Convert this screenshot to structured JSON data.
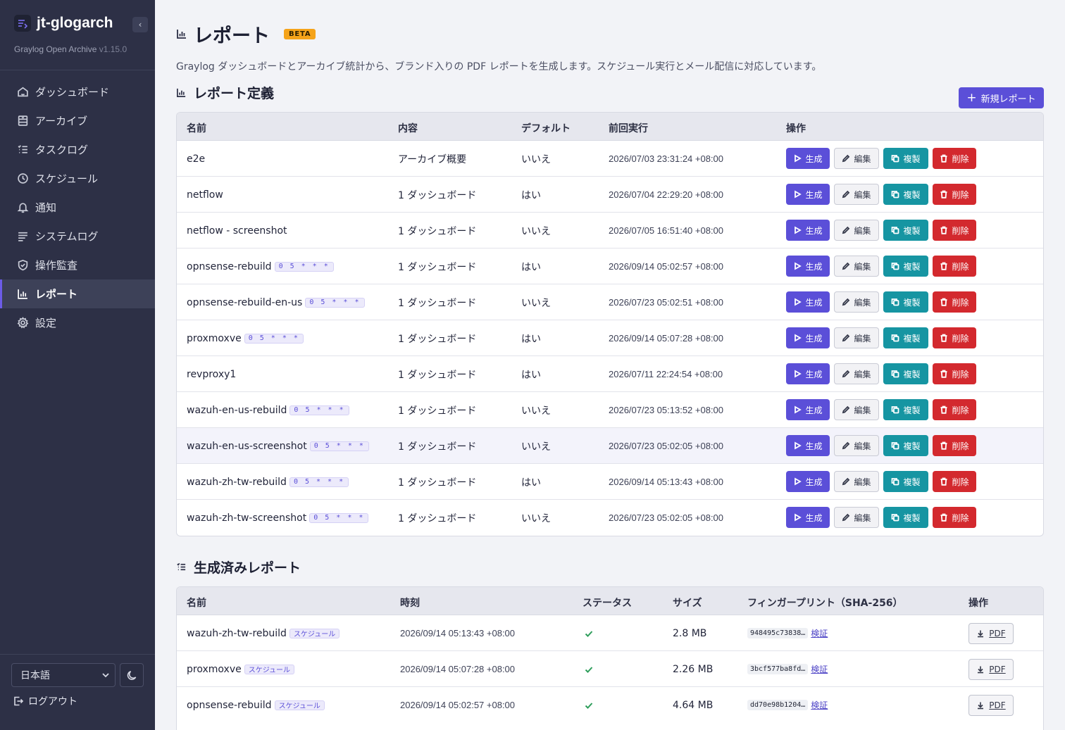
{
  "brand": {
    "name": "jt-glogarch",
    "subtitle": "Graylog Open Archive",
    "version": "v1.15.0",
    "collapse": "‹"
  },
  "nav": [
    {
      "label": "ダッシュボード",
      "icon": "home-icon"
    },
    {
      "label": "アーカイブ",
      "icon": "archive-icon"
    },
    {
      "label": "タスクログ",
      "icon": "list-icon"
    },
    {
      "label": "スケジュール",
      "icon": "clock-icon"
    },
    {
      "label": "通知",
      "icon": "bell-icon"
    },
    {
      "label": "システムログ",
      "icon": "lines-icon"
    },
    {
      "label": "操作監査",
      "icon": "shield-icon"
    },
    {
      "label": "レポート",
      "icon": "chart-icon",
      "active": true
    },
    {
      "label": "設定",
      "icon": "gear-icon"
    }
  ],
  "sidebar_bottom": {
    "language": "日本語",
    "logout": "ログアウト"
  },
  "page": {
    "title": "レポート",
    "badge": "BETA",
    "description": "Graylog ダッシュボードとアーカイブ統計から、ブランド入りの PDF レポートを生成します。スケジュール実行とメール配信に対応しています。"
  },
  "definitions": {
    "title": "レポート定義",
    "new_button": "新規レポート",
    "columns": [
      "名前",
      "内容",
      "デフォルト",
      "前回実行",
      "操作"
    ],
    "actions": {
      "generate": "生成",
      "edit": "編集",
      "duplicate": "複製",
      "delete": "削除"
    },
    "rows": [
      {
        "name": "e2e",
        "tag": "",
        "content": "アーカイブ概要",
        "default": "いいえ",
        "last_run": "2026/07/03 23:31:24 +08:00"
      },
      {
        "name": "netflow",
        "tag": "",
        "content": "1 ダッシュボード",
        "default": "はい",
        "last_run": "2026/07/04 22:29:20 +08:00"
      },
      {
        "name": "netflow - screenshot",
        "tag": "",
        "content": "1 ダッシュボード",
        "default": "いいえ",
        "last_run": "2026/07/05 16:51:40 +08:00"
      },
      {
        "name": "opnsense-rebuild",
        "tag": "0 5 * * *",
        "content": "1 ダッシュボード",
        "default": "はい",
        "last_run": "2026/09/14 05:02:57 +08:00"
      },
      {
        "name": "opnsense-rebuild-en-us",
        "tag": "0 5 * * *",
        "content": "1 ダッシュボード",
        "default": "いいえ",
        "last_run": "2026/07/23 05:02:51 +08:00"
      },
      {
        "name": "proxmoxve",
        "tag": "0 5 * * *",
        "content": "1 ダッシュボード",
        "default": "はい",
        "last_run": "2026/09/14 05:07:28 +08:00"
      },
      {
        "name": "revproxy1",
        "tag": "",
        "content": "1 ダッシュボード",
        "default": "はい",
        "last_run": "2026/07/11 22:24:54 +08:00"
      },
      {
        "name": "wazuh-en-us-rebuild",
        "tag": "0 5 * * *",
        "content": "1 ダッシュボード",
        "default": "いいえ",
        "last_run": "2026/07/23 05:13:52 +08:00"
      },
      {
        "name": "wazuh-en-us-screenshot",
        "tag": "0 5 * * *",
        "content": "1 ダッシュボード",
        "default": "いいえ",
        "last_run": "2026/07/23 05:02:05 +08:00"
      },
      {
        "name": "wazuh-zh-tw-rebuild",
        "tag": "0 5 * * *",
        "content": "1 ダッシュボード",
        "default": "はい",
        "last_run": "2026/09/14 05:13:43 +08:00"
      },
      {
        "name": "wazuh-zh-tw-screenshot",
        "tag": "0 5 * * *",
        "content": "1 ダッシュボード",
        "default": "いいえ",
        "last_run": "2026/07/23 05:02:05 +08:00"
      }
    ]
  },
  "generated": {
    "title": "生成済みレポート",
    "columns": [
      "名前",
      "時刻",
      "ステータス",
      "サイズ",
      "フィンガープリント（SHA-256）",
      "操作"
    ],
    "verify_label": "検証",
    "pdf_label": "PDF",
    "rows": [
      {
        "name": "wazuh-zh-tw-rebuild",
        "tag": "スケジュール",
        "time": "2026/09/14 05:13:43 +08:00",
        "status": "success",
        "size": "2.8 MB",
        "fingerprint": "948495c73838…"
      },
      {
        "name": "proxmoxve",
        "tag": "スケジュール",
        "time": "2026/09/14 05:07:28 +08:00",
        "status": "success",
        "size": "2.26 MB",
        "fingerprint": "3bcf577ba8fd…"
      },
      {
        "name": "opnsense-rebuild",
        "tag": "スケジュール",
        "time": "2026/09/14 05:02:57 +08:00",
        "status": "success",
        "size": "4.64 MB",
        "fingerprint": "dd70e98b1204…"
      }
    ]
  },
  "colors": {
    "sidebar": "#2d3046",
    "accent": "#5b4fd8",
    "teal": "#1695a2",
    "danger": "#d3292e",
    "beta": "#f5a31a"
  }
}
